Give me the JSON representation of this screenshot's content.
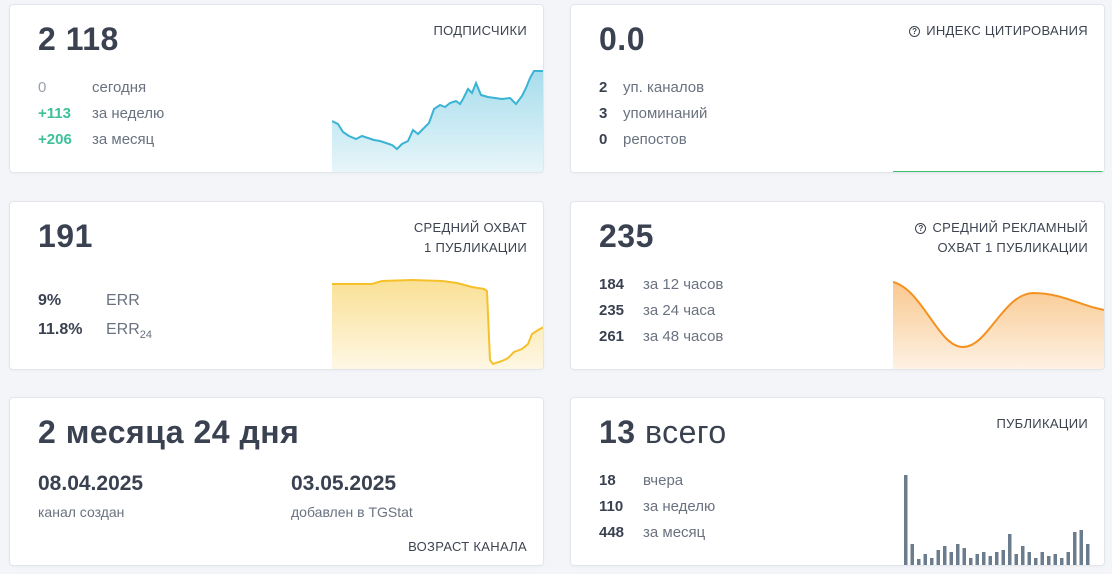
{
  "subscribers": {
    "value": "2 118",
    "label": "ПОДПИСЧИКИ",
    "rows": [
      {
        "num": "0",
        "text": "сегодня"
      },
      {
        "num": "+113",
        "text": "за неделю"
      },
      {
        "num": "+206",
        "text": "за месяц"
      }
    ],
    "color": "#3bb3d4"
  },
  "citation": {
    "value": "0.0",
    "label": "ИНДЕКС ЦИТИРОВАНИЯ",
    "icon": "info-icon",
    "rows": [
      {
        "num": "2",
        "text": "уп. каналов"
      },
      {
        "num": "3",
        "text": "упоминаний"
      },
      {
        "num": "0",
        "text": "репостов"
      }
    ],
    "color": "#3ec16a"
  },
  "reach": {
    "value": "191",
    "label_line1": "СРЕДНИЙ ОХВАТ",
    "label_line2": "1 ПУБЛИКАЦИИ",
    "err": {
      "num": "9%",
      "text": "ERR"
    },
    "err24": {
      "num": "11.8%",
      "text": "ERR",
      "sub": "24"
    },
    "color": "#f5c12a"
  },
  "ad_reach": {
    "value": "235",
    "label_line1": "СРЕДНИЙ РЕКЛАМНЫЙ",
    "label_line2": "ОХВАТ 1 ПУБЛИКАЦИИ",
    "icon": "info-icon",
    "rows": [
      {
        "num": "184",
        "text": "за 12 часов"
      },
      {
        "num": "235",
        "text": "за 24 часа"
      },
      {
        "num": "261",
        "text": "за 48 часов"
      }
    ],
    "color": "#f39221"
  },
  "age": {
    "value": "2 месяца 24 дня",
    "label": "ВОЗРАСТ КАНАЛА",
    "created_date": "08.04.2025",
    "created_caption": "канал создан",
    "added_date": "03.05.2025",
    "added_caption": "добавлен в TGStat"
  },
  "publications": {
    "value": "13",
    "value_suffix": "всего",
    "label": "ПУБЛИКАЦИИ",
    "rows": [
      {
        "num": "18",
        "text": "вчера"
      },
      {
        "num": "110",
        "text": "за неделю"
      },
      {
        "num": "448",
        "text": "за месяц"
      }
    ],
    "bar_color": "#6b7c8c"
  }
}
